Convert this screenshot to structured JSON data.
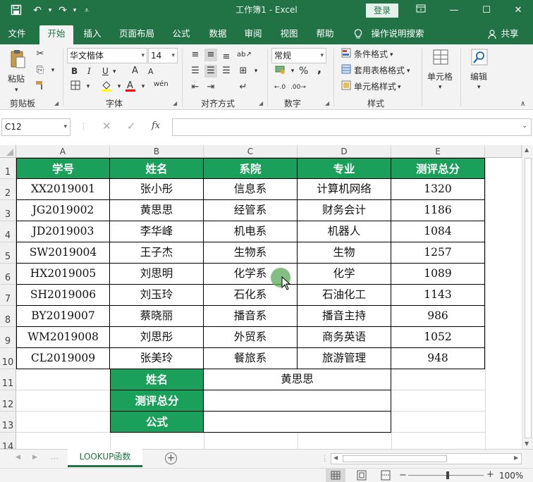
{
  "titlebar": {
    "title": "工作簿1 - Excel",
    "login_label": "登录",
    "icons": [
      "save-icon",
      "undo-icon",
      "redo-icon",
      "customize-icon",
      "ribbon-display-icon",
      "minimize-icon",
      "maximize-icon",
      "close-icon"
    ]
  },
  "tabs": {
    "items": [
      "文件",
      "开始",
      "插入",
      "页面布局",
      "公式",
      "数据",
      "审阅",
      "视图",
      "帮助"
    ],
    "active": "开始",
    "search_label": "操作说明搜索",
    "share_label": "共享"
  },
  "ribbon": {
    "clipboard": {
      "label": "剪贴板",
      "paste_label": "粘贴"
    },
    "font": {
      "label": "字体",
      "font_name": "华文楷体",
      "font_size": "14",
      "bold": "B",
      "italic": "I",
      "underline": "U",
      "grow": "A",
      "shrink": "A",
      "phonetic": "wén"
    },
    "alignment": {
      "label": "对齐方式"
    },
    "number": {
      "label": "数字",
      "format": "常规",
      "percent": "%",
      "comma": ","
    },
    "styles": {
      "label": "样式",
      "conditional": "条件格式",
      "table": "套用表格格式",
      "cell_styles": "单元格样式"
    },
    "cells": {
      "label": "单元格"
    },
    "editing": {
      "label": "编辑"
    }
  },
  "formula_bar": {
    "name_box": "C12",
    "fx": "fx",
    "value": ""
  },
  "grid": {
    "columns": [
      "A",
      "B",
      "C",
      "D",
      "E"
    ],
    "rows": [
      "1",
      "2",
      "3",
      "4",
      "5",
      "6",
      "7",
      "8",
      "9",
      "10",
      "11",
      "12",
      "13",
      "14"
    ],
    "headers": [
      "学号",
      "姓名",
      "系院",
      "专业",
      "测评总分"
    ],
    "data": [
      [
        "XX2019001",
        "张小彤",
        "信息系",
        "计算机网络",
        "1320"
      ],
      [
        "JG2019002",
        "黄思思",
        "经管系",
        "财务会计",
        "1186"
      ],
      [
        "JD2019003",
        "李华峰",
        "机电系",
        "机器人",
        "1084"
      ],
      [
        "SW2019004",
        "王子杰",
        "生物系",
        "生物",
        "1257"
      ],
      [
        "HX2019005",
        "刘思明",
        "化学系",
        "化学",
        "1089"
      ],
      [
        "SH2019006",
        "刘玉玲",
        "石化系",
        "石油化工",
        "1143"
      ],
      [
        "BY2019007",
        "蔡晓丽",
        "播音系",
        "播音主持",
        "986"
      ],
      [
        "WM2019008",
        "刘思彤",
        "外贸系",
        "商务英语",
        "1052"
      ],
      [
        "CL2019009",
        "张美玲",
        "餐旅系",
        "旅游管理",
        "948"
      ]
    ],
    "lookup": [
      {
        "label": "姓名",
        "value": "黄思思"
      },
      {
        "label": "测评总分",
        "value": ""
      },
      {
        "label": "公式",
        "value": ""
      }
    ],
    "header_color": "#1aa05a"
  },
  "sheets": {
    "active": "LOOKUP函数"
  },
  "status": {
    "zoom": "100%"
  }
}
